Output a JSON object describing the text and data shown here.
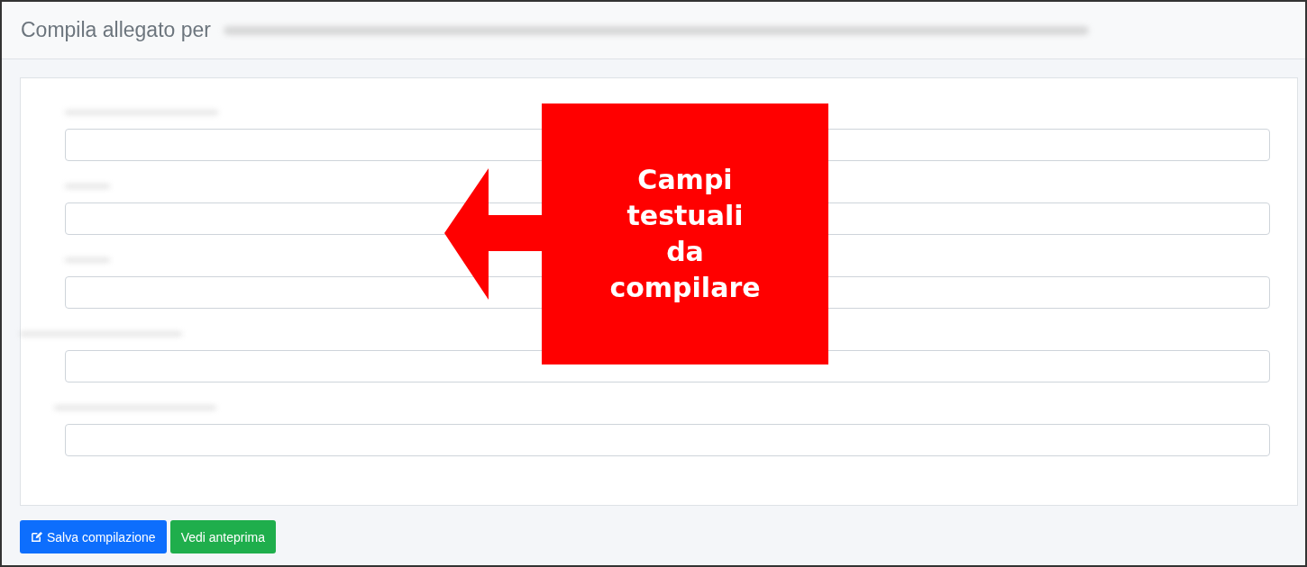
{
  "header": {
    "title": "Compila allegato per",
    "title_redacted": true
  },
  "fields": [
    {
      "kind": "text",
      "label_redacted": true
    },
    {
      "kind": "text",
      "label_redacted": true
    },
    {
      "kind": "text",
      "label_redacted": true
    },
    {
      "kind": "text",
      "label_redacted": true
    },
    {
      "kind": "text",
      "label_redacted": true
    }
  ],
  "buttons": [
    {
      "label": "Salva compilazione",
      "kind": "primary"
    },
    {
      "label": "Vedi anteprima",
      "kind": "success"
    }
  ],
  "callout": {
    "text": "Campi testuali da compilare"
  }
}
